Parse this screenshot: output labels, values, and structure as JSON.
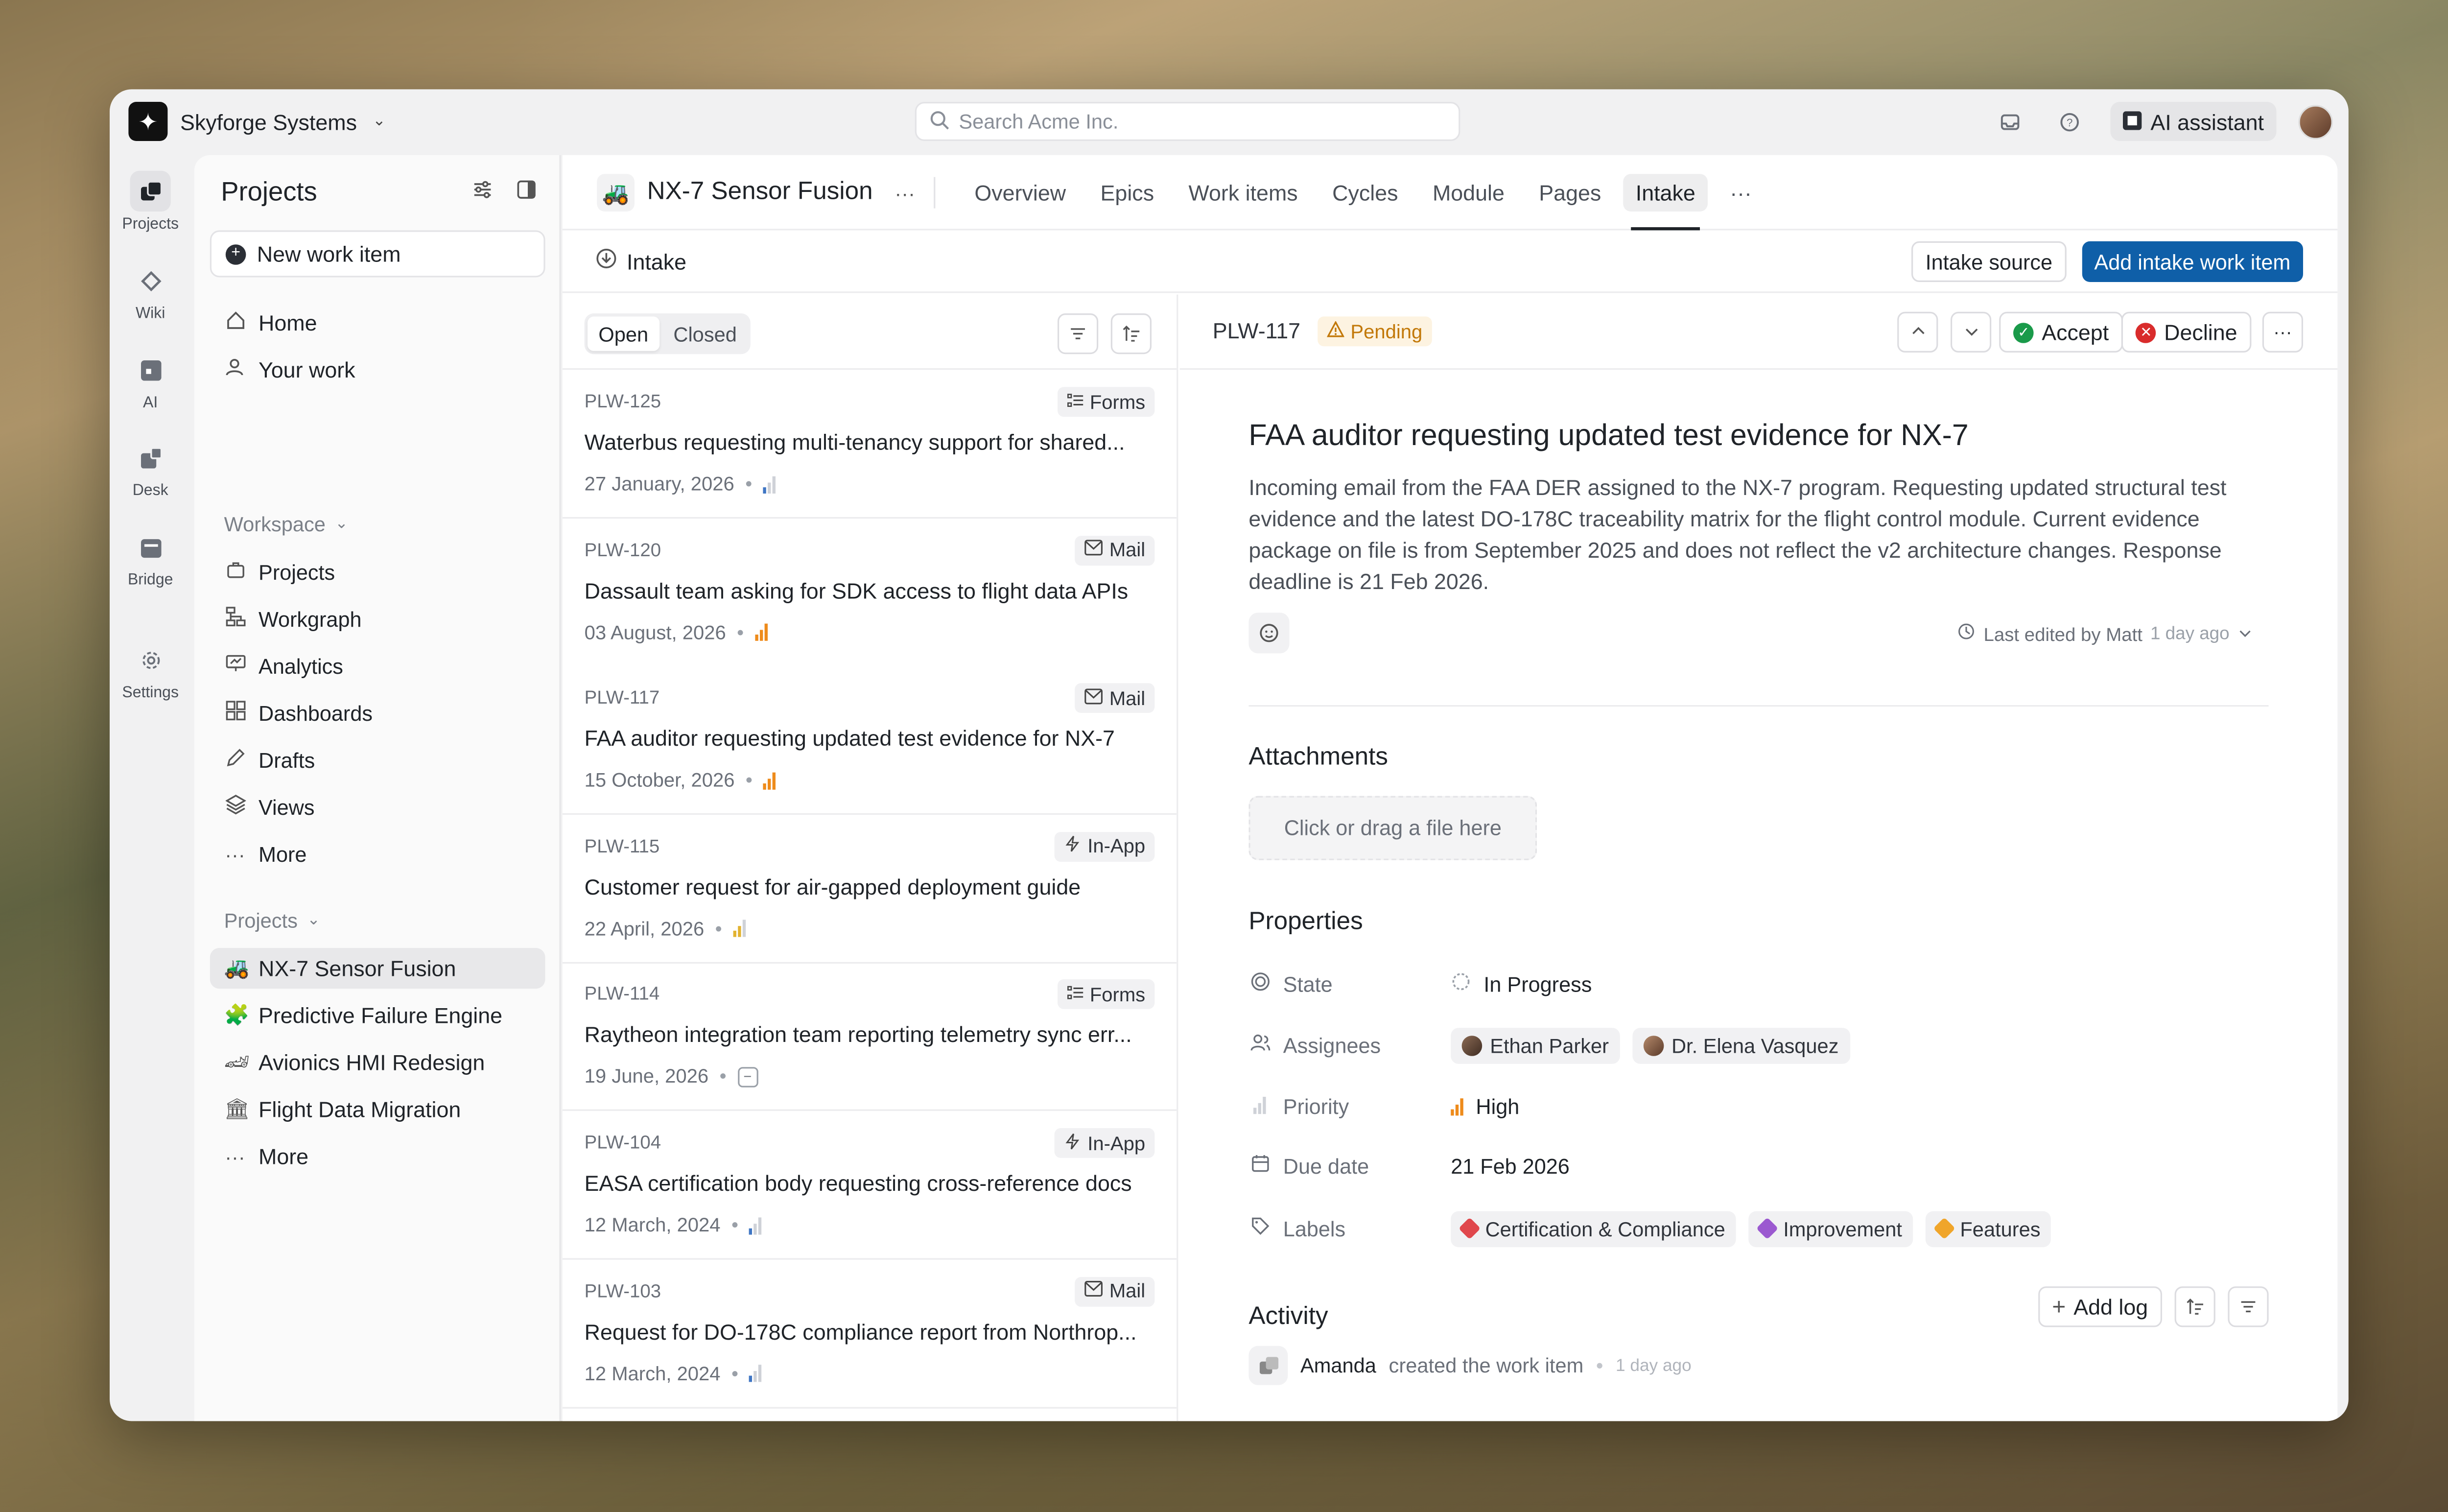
{
  "workspace": {
    "name": "Skyforge Systems"
  },
  "search": {
    "placeholder": "Search Acme Inc."
  },
  "topbar": {
    "ai_assistant": "AI assistant"
  },
  "rail": [
    {
      "label": "Projects",
      "icon": "projects-icon"
    },
    {
      "label": "Wiki",
      "icon": "wiki-icon"
    },
    {
      "label": "AI",
      "icon": "ai-icon"
    },
    {
      "label": "Desk",
      "icon": "desk-icon"
    },
    {
      "label": "Bridge",
      "icon": "bridge-icon"
    },
    {
      "label": "Settings",
      "icon": "gear-icon"
    }
  ],
  "sidebar": {
    "title": "Projects",
    "new_item": "New work item",
    "top_items": [
      {
        "label": "Home",
        "icon": "home-icon"
      },
      {
        "label": "Your work",
        "icon": "user-icon"
      }
    ],
    "workspace_label": "Workspace",
    "workspace_items": [
      {
        "label": "Projects",
        "icon": "briefcase-icon"
      },
      {
        "label": "Workgraph",
        "icon": "graph-icon"
      },
      {
        "label": "Analytics",
        "icon": "analytics-icon"
      },
      {
        "label": "Dashboards",
        "icon": "dashboard-icon"
      },
      {
        "label": "Drafts",
        "icon": "pencil-icon"
      },
      {
        "label": "Views",
        "icon": "layers-icon"
      },
      {
        "label": "More",
        "icon": "ellipsis-icon"
      }
    ],
    "projects_label": "Projects",
    "projects": [
      {
        "label": "NX-7 Sensor Fusion",
        "emoji": "🚜"
      },
      {
        "label": "Predictive Failure Engine",
        "emoji": "🧩"
      },
      {
        "label": "Avionics HMI Redesign",
        "emoji": "🏎"
      },
      {
        "label": "Flight Data Migration",
        "emoji": "🏛"
      },
      {
        "label": "More",
        "emoji": "···"
      }
    ]
  },
  "project": {
    "emoji": "🚜",
    "name": "NX-7 Sensor Fusion",
    "tabs": [
      "Overview",
      "Epics",
      "Work items",
      "Cycles",
      "Module",
      "Pages",
      "Intake"
    ],
    "active_tab": "Intake"
  },
  "intake_bar": {
    "label": "Intake",
    "intake_source": "Intake source",
    "add_button": "Add intake work item"
  },
  "list": {
    "filters": {
      "open": "Open",
      "closed": "Closed"
    },
    "items": [
      {
        "id": "PLW-125",
        "source": "Forms",
        "source_icon": "forms-icon",
        "title": "Waterbus requesting multi-tenancy support for shared...",
        "date": "27 January, 2026",
        "priority": "low"
      },
      {
        "id": "PLW-120",
        "source": "Mail",
        "source_icon": "mail-icon",
        "title": "Dassault team asking for SDK access to flight data APIs",
        "date": "03 August, 2026",
        "priority": "high"
      },
      {
        "id": "PLW-117",
        "source": "Mail",
        "source_icon": "mail-icon",
        "title": "FAA auditor requesting updated test evidence for NX-7",
        "date": "15 October, 2026",
        "priority": "high"
      },
      {
        "id": "PLW-115",
        "source": "In-App",
        "source_icon": "bolt-icon",
        "title": "Customer request for air-gapped deployment guide",
        "date": "22 April, 2026",
        "priority": "medium"
      },
      {
        "id": "PLW-114",
        "source": "Forms",
        "source_icon": "forms-icon",
        "title": "Raytheon integration team reporting telemetry sync err...",
        "date": "19 June, 2026",
        "priority": "none"
      },
      {
        "id": "PLW-104",
        "source": "In-App",
        "source_icon": "bolt-icon",
        "title": "EASA certification body requesting cross-reference docs",
        "date": "12 March, 2024",
        "priority": "low"
      },
      {
        "id": "PLW-103",
        "source": "Mail",
        "source_icon": "mail-icon",
        "title": "Request for DO-178C compliance report from Northrop...",
        "date": "12 March, 2024",
        "priority": "low"
      }
    ]
  },
  "detail": {
    "id": "PLW-117",
    "status": "Pending",
    "accept": "Accept",
    "decline": "Decline",
    "title": "FAA auditor requesting updated test evidence for NX-7",
    "description": "Incoming email from the FAA DER assigned to the NX-7 program. Requesting updated structural test evidence and the latest DO-178C traceability matrix for the flight control module. Current evidence package on file is from September 2025 and does not reflect the v2 architecture changes. Response deadline is 21 Feb 2026.",
    "last_edited_by": "Last edited by Matt",
    "last_edited_time": "1 day ago",
    "attachments_heading": "Attachments",
    "upload_text": "Click or drag a file here",
    "properties_heading": "Properties",
    "properties": {
      "state_label": "State",
      "state_value": "In Progress",
      "assignees_label": "Assignees",
      "assignees": [
        "Ethan Parker",
        "Dr. Elena Vasquez"
      ],
      "priority_label": "Priority",
      "priority_value": "High",
      "due_label": "Due date",
      "due_value": "21 Feb 2026",
      "labels_label": "Labels",
      "labels": [
        {
          "name": "Certification & Compliance",
          "color": "#e0474c"
        },
        {
          "name": "Improvement",
          "color": "#9b59d0"
        },
        {
          "name": "Features",
          "color": "#f0a52a"
        }
      ]
    },
    "activity_heading": "Activity",
    "add_log": "Add log",
    "activity": {
      "user": "Amanda",
      "action": "created the work item",
      "time": "1 day ago"
    }
  },
  "colors": {
    "primary": "#0f5fa8",
    "pending_bg": "#fdf3e1",
    "pending_fg": "#c27808",
    "accept": "#1a9a4a",
    "decline": "#d92c2c",
    "priority_high": "#ee8b1b"
  }
}
